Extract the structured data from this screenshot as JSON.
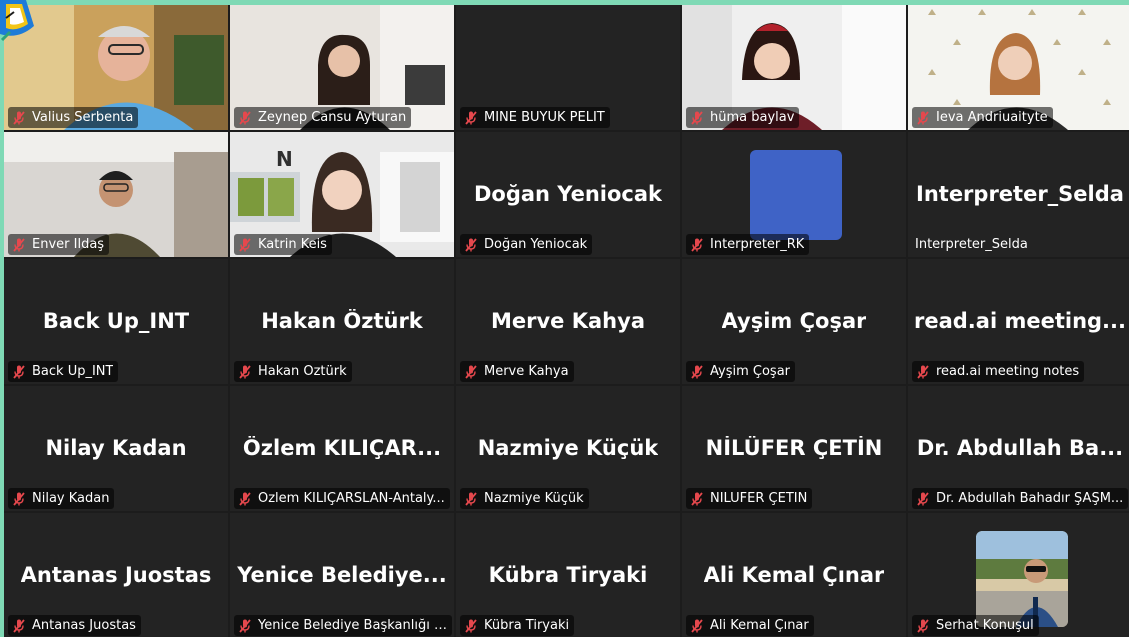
{
  "colors": {
    "frame_border": "#7fd9b5",
    "grid_background": "#1c1c1c",
    "tile_background": "#232323",
    "muted_mic": "#e5484d",
    "avatar_blue": "#3f63c6"
  },
  "participants": [
    {
      "id": "valius",
      "name": "Valius Serbenta",
      "display": "",
      "video": true
    },
    {
      "id": "zeynep",
      "name": "Zeynep Cansu Ayturan",
      "display": "",
      "video": true
    },
    {
      "id": "mine",
      "name": "MİNE BÜYÜK PELİT",
      "display": "",
      "video": false
    },
    {
      "id": "huma",
      "name": "hüma baylav",
      "display": "",
      "video": true
    },
    {
      "id": "ieva",
      "name": "Ieva Andriuaityte",
      "display": "",
      "video": true
    },
    {
      "id": "enver",
      "name": "Enver İldaş",
      "display": "",
      "video": true
    },
    {
      "id": "katrin",
      "name": "Katrin Keis",
      "display": "",
      "video": true
    },
    {
      "id": "dogan",
      "name": "Doğan Yeniocak",
      "display": "Doğan Yeniocak",
      "video": false
    },
    {
      "id": "rk",
      "name": "Interpreter_RK",
      "display": "",
      "video": false,
      "avatar": true
    },
    {
      "id": "selda",
      "name": "Interpreter_Selda",
      "display": "Interpreter_Selda",
      "video": false,
      "plain_label": true
    },
    {
      "id": "backup",
      "name": "Back Up_INT",
      "display": "Back Up_INT",
      "video": false
    },
    {
      "id": "hakan",
      "name": "Hakan Öztürk",
      "display": "Hakan Öztürk",
      "video": false
    },
    {
      "id": "merve",
      "name": "Merve Kahya",
      "display": "Merve Kahya",
      "video": false
    },
    {
      "id": "aysim",
      "name": "Ayşim Çoşar",
      "display": "Ayşim Çoşar",
      "video": false
    },
    {
      "id": "readai",
      "name": "read.ai meeting notes",
      "display": "read.ai  meeting...",
      "video": false
    },
    {
      "id": "nilay",
      "name": "Nilay Kadan",
      "display": "Nilay Kadan",
      "video": false
    },
    {
      "id": "ozlem",
      "name": "Özlem KILIÇARSLAN-Antaly...",
      "display": "Özlem  KILIÇAR...",
      "video": false
    },
    {
      "id": "nazmiye",
      "name": "Nazmiye Küçük",
      "display": "Nazmiye Küçük",
      "video": false
    },
    {
      "id": "nilufer",
      "name": "NİLÜFER ÇETİN",
      "display": "NİLÜFER ÇETİN",
      "video": false
    },
    {
      "id": "abdullah",
      "name": "Dr. Abdullah Bahadır ŞAŞM...",
      "display": "Dr. Abdullah  Ba...",
      "video": false
    },
    {
      "id": "antanas",
      "name": "Antanas Juostas",
      "display": "Antanas Juostas",
      "video": false
    },
    {
      "id": "yenice",
      "name": "Yenice Belediye Başkanlığı S...",
      "display": "Yenice  Belediye...",
      "video": false
    },
    {
      "id": "kubra",
      "name": "Kübra Tiryaki",
      "display": "Kübra Tiryaki",
      "video": false
    },
    {
      "id": "alikemal",
      "name": "Ali Kemal Çınar",
      "display": "Ali Kemal Çınar",
      "video": false
    },
    {
      "id": "serhat",
      "name": "Serhat Konuşul",
      "display": "",
      "video": false,
      "photo": true
    }
  ]
}
